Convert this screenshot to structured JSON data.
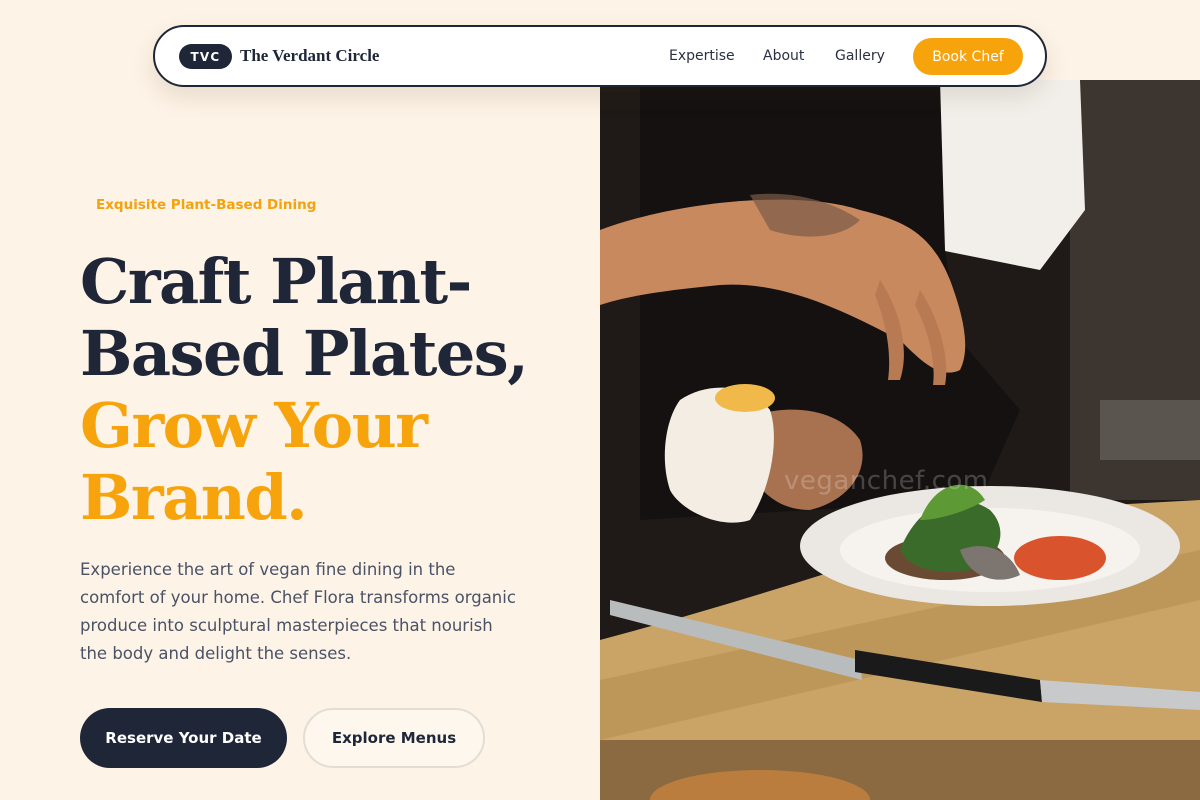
{
  "navbar": {
    "logo_badge": "TVC",
    "brand_name": "The Verdant Circle",
    "links": [
      {
        "label": "Expertise"
      },
      {
        "label": "About"
      },
      {
        "label": "Gallery"
      }
    ],
    "cta_label": "Book Chef"
  },
  "hero": {
    "eyebrow": "Exquisite Plant-Based Dining",
    "headline_dark_1": "Craft Plant-",
    "headline_dark_2": "Based Plates,",
    "headline_accent_1": "Grow Your",
    "headline_accent_2": "Brand.",
    "description": "Experience the art of vegan fine dining in the comfort of your home. Chef Flora transforms organic produce into sculptural masterpieces that nourish the body and delight the senses.",
    "primary_button": "Reserve Your Date",
    "secondary_button": "Explore Menus"
  },
  "image": {
    "subject": "chef-seasoning-plated-dish-photo",
    "watermark": "veganchef.com"
  },
  "colors": {
    "background": "#fdf3e6",
    "navy": "#1e2638",
    "accent": "#f7a30c",
    "body_text": "#4a5266"
  }
}
